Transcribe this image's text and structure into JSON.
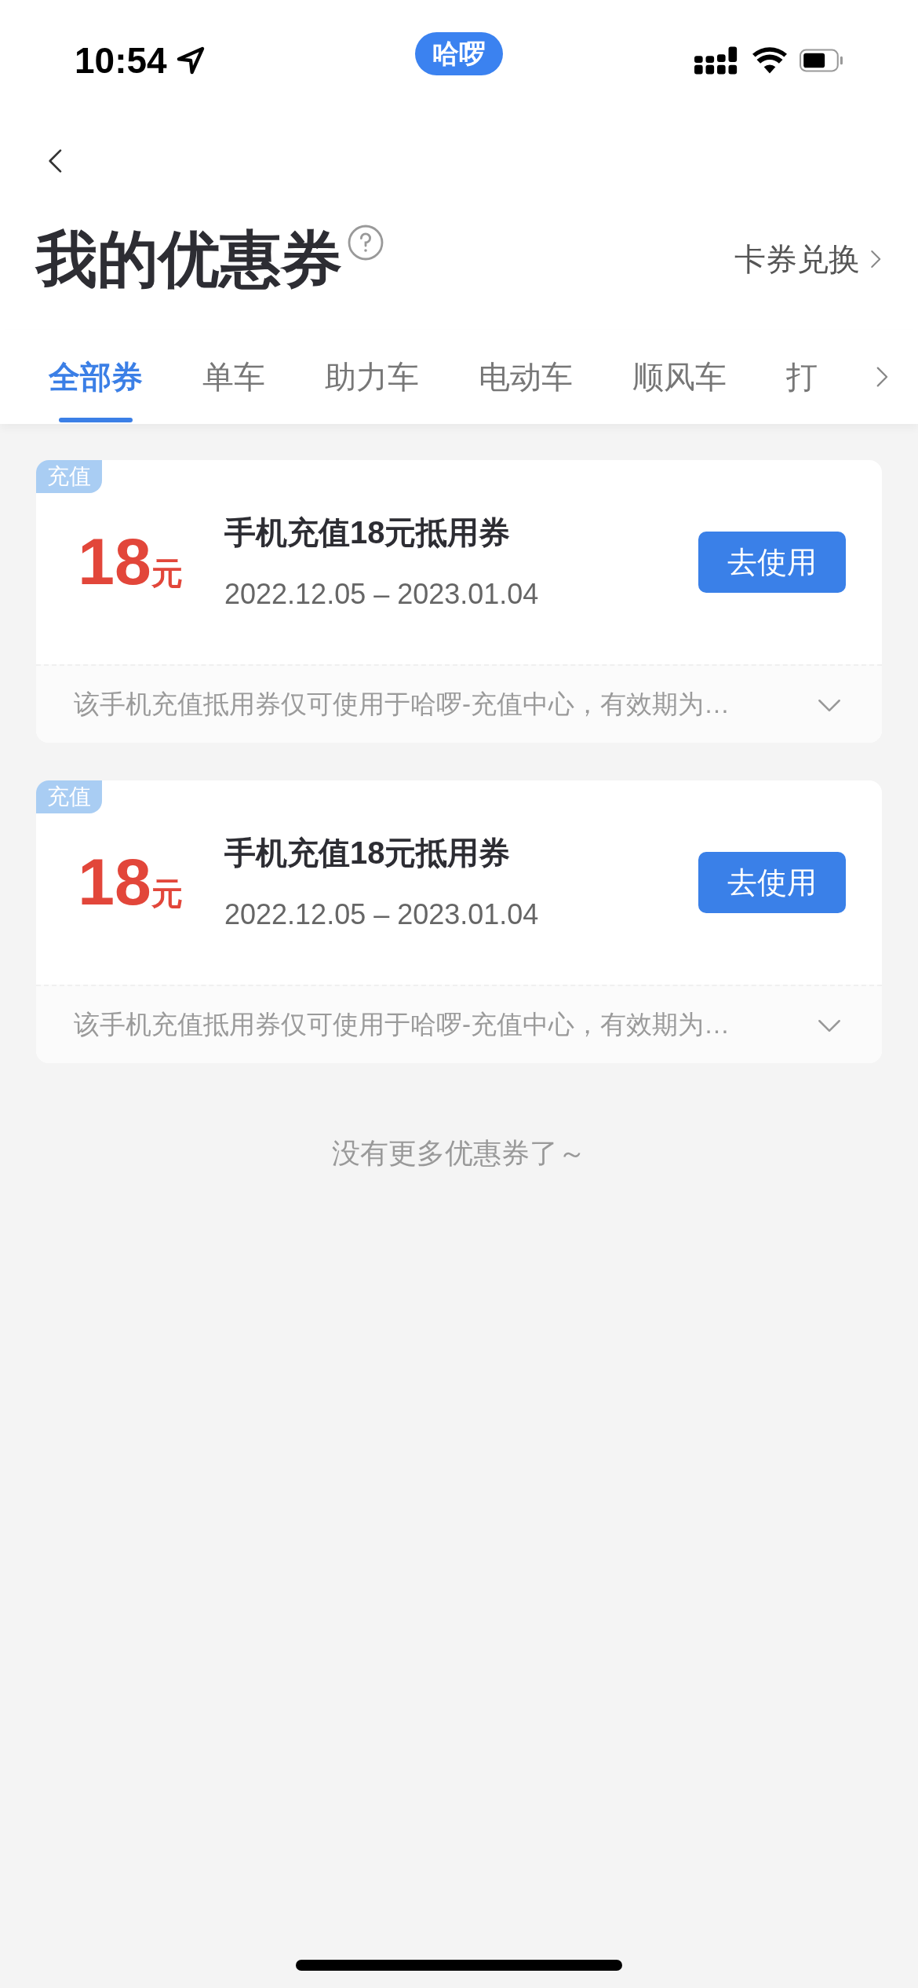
{
  "status_bar": {
    "time": "10:54",
    "app_pill": "哈啰"
  },
  "header": {
    "title": "我的优惠券",
    "exchange_link": "卡券兑换"
  },
  "tabs": [
    {
      "label": "全部券",
      "selected": true
    },
    {
      "label": "单车",
      "selected": false
    },
    {
      "label": "助力车",
      "selected": false
    },
    {
      "label": "电动车",
      "selected": false
    },
    {
      "label": "顺风车",
      "selected": false
    },
    {
      "label": "打",
      "selected": false
    }
  ],
  "coupons": [
    {
      "tag": "充值",
      "amount": "18",
      "unit": "元",
      "name": "手机充值18元抵用券",
      "validity": "2022.12.05 – 2023.01.04",
      "action": "去使用",
      "description": "该手机充值抵用券仅可使用于哈啰-充值中心，有效期为…",
      "expanded": false
    },
    {
      "tag": "充值",
      "amount": "18",
      "unit": "元",
      "name": "手机充值18元抵用券",
      "validity": "2022.12.05 – 2023.01.04",
      "action": "去使用",
      "description": "该手机充值抵用券仅可使用于哈啰-充值中心，有效期为…",
      "expanded": false
    }
  ],
  "end_note": "没有更多优惠券了～"
}
